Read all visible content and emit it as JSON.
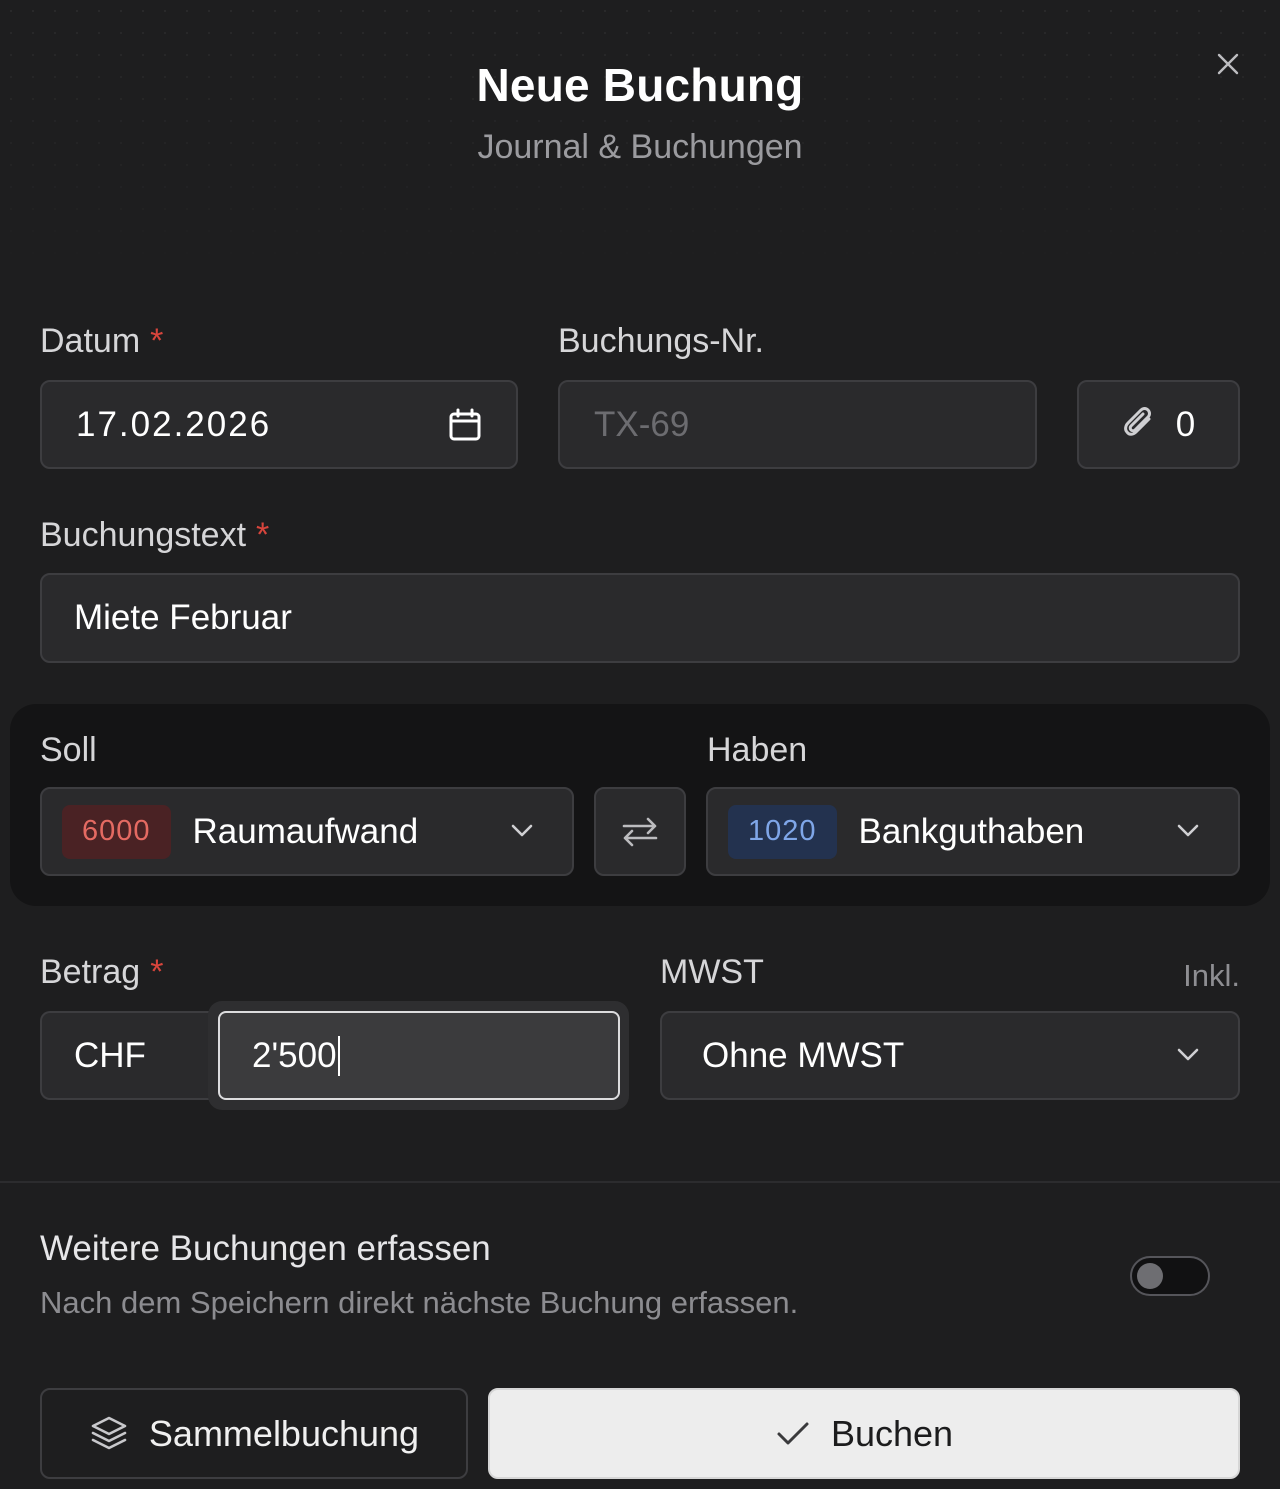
{
  "dialog": {
    "title": "Neue Buchung",
    "subtitle": "Journal & Buchungen",
    "close_icon": "close-icon"
  },
  "form": {
    "date": {
      "label": "Datum",
      "required_mark": "*",
      "value": "17.02.2026",
      "icon": "calendar-icon"
    },
    "booking_number": {
      "label": "Buchungs-Nr.",
      "placeholder": "TX-69"
    },
    "attachments": {
      "icon": "paperclip-icon",
      "count": "0"
    },
    "booking_text": {
      "label": "Buchungstext",
      "required_mark": "*",
      "value": "Miete Februar"
    },
    "debit": {
      "label": "Soll",
      "account_number": "6000",
      "account_name": "Raumaufwand",
      "icon": "chevron-down-icon"
    },
    "swap": {
      "icon": "swap-arrows-icon"
    },
    "credit": {
      "label": "Haben",
      "account_number": "1020",
      "account_name": "Bankguthaben",
      "icon": "chevron-down-icon"
    },
    "amount": {
      "label": "Betrag",
      "required_mark": "*",
      "currency": "CHF",
      "value": "2'500"
    },
    "vat": {
      "label": "MWST",
      "mode": "Inkl.",
      "value": "Ohne MWST",
      "icon": "chevron-down-icon"
    }
  },
  "footer": {
    "more_bookings": {
      "title": "Weitere Buchungen erfassen",
      "description": "Nach dem Speichern direkt nächste Buchung erfassen.",
      "enabled": false
    },
    "batch_button": {
      "label": "Sammelbuchung",
      "icon": "layers-icon"
    },
    "submit_button": {
      "label": "Buchen",
      "icon": "check-icon"
    }
  },
  "colors": {
    "background": "#1e1e1f",
    "field": "#2a2a2c",
    "required": "#d8453c",
    "debit_badge": "#4a2224",
    "credit_badge": "#23324f",
    "primary_button": "#ededed"
  }
}
